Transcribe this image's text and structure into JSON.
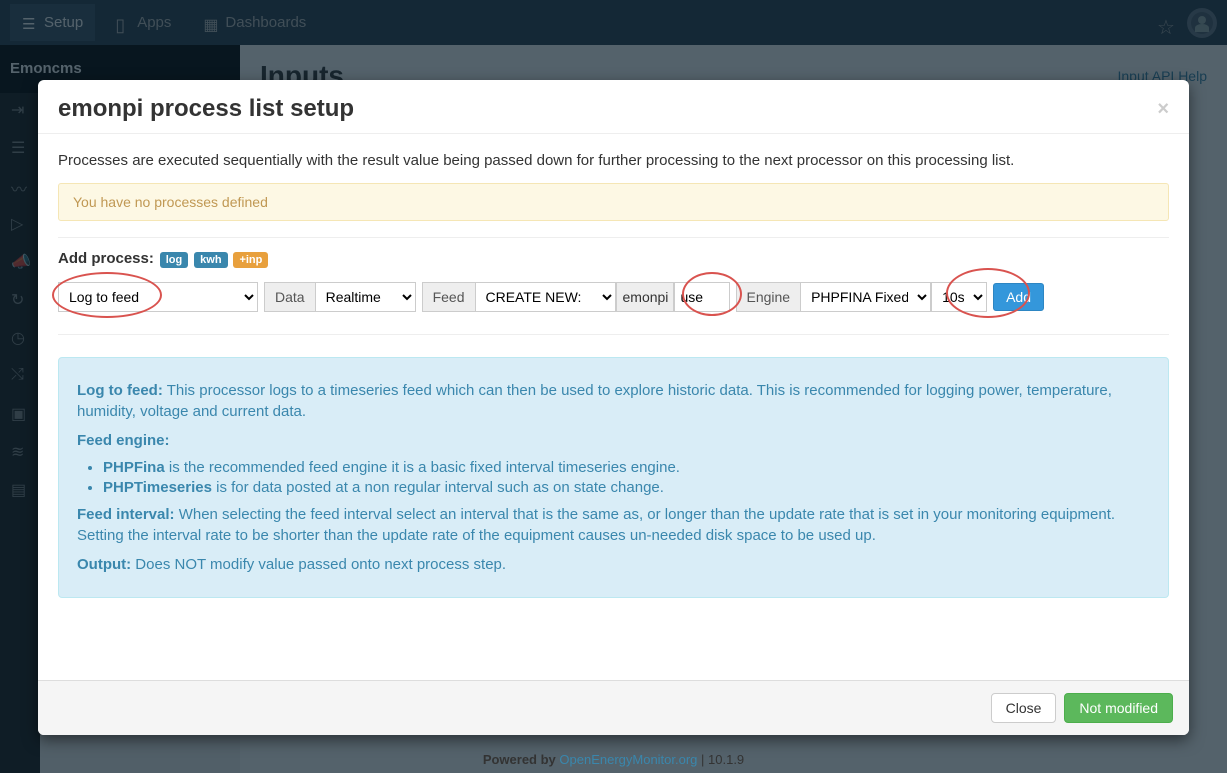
{
  "topbar": {
    "setup": "Setup",
    "apps": "Apps",
    "dashboards": "Dashboards"
  },
  "sidebar": {
    "logo": "Emoncms"
  },
  "page": {
    "title": "Inputs",
    "api_help": "Input API Help"
  },
  "modal": {
    "title": "emonpi process list setup",
    "intro": "Processes are executed sequentially with the result value being passed down for further processing to the next processor on this processing list.",
    "no_processes": "You have no processes defined",
    "add_label": "Add process:",
    "tags": {
      "log": "log",
      "kwh": "kwh",
      "inp": "+inp"
    },
    "form": {
      "process_sel": "Log to feed",
      "data_label": "Data",
      "data_sel": "Realtime",
      "feed_label": "Feed",
      "feed_sel": "CREATE NEW:",
      "feed_prefix": "emonpi",
      "feed_name": "use",
      "engine_label": "Engine",
      "engine_sel": "PHPFINA Fixed Inte",
      "interval_sel": "10s",
      "add_btn": "Add"
    },
    "info": {
      "log_to_feed_label": "Log to feed:",
      "log_to_feed_text": " This processor logs to a timeseries feed which can then be used to explore historic data. This is recommended for logging power, temperature, humidity, voltage and current data.",
      "feed_engine_label": "Feed engine:",
      "phpfina_name": "PHPFina",
      "phpfina_text": " is the recommended feed engine it is a basic fixed interval timeseries engine.",
      "phptimeseries_name": "PHPTimeseries",
      "phptimeseries_text": " is for data posted at a non regular interval such as on state change.",
      "feed_interval_label": "Feed interval:",
      "feed_interval_text": " When selecting the feed interval select an interval that is the same as, or longer than the update rate that is set in your monitoring equipment. Setting the interval rate to be shorter than the update rate of the equipment causes un-needed disk space to be used up.",
      "output_label": "Output:",
      "output_text": " Does NOT modify value passed onto next process step."
    },
    "footer": {
      "close": "Close",
      "not_modified": "Not modified"
    }
  },
  "footer": {
    "powered_by": "Powered by ",
    "org": "OpenEnergyMonitor.org",
    "version": " | 10.1.9"
  }
}
